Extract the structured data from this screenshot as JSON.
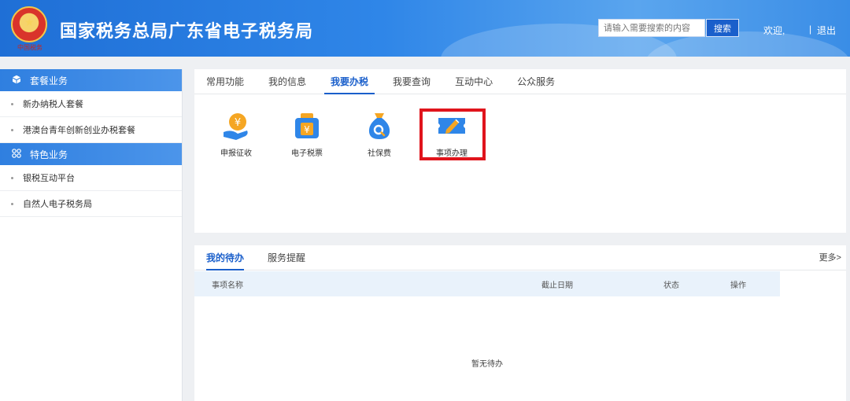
{
  "header": {
    "title": "国家税务总局广东省电子税务局",
    "emblem_caption": "中国税务",
    "search_placeholder": "请输入需要搜索的内容",
    "search_button": "搜索",
    "welcome": "欢迎,",
    "separator": "|",
    "logout": "退出",
    "accent_color": "#2f86e8"
  },
  "sidebar": {
    "groups": [
      {
        "label": "套餐业务",
        "icon": "cube-icon",
        "items": [
          "新办纳税人套餐",
          "港澳台青年创新创业办税套餐"
        ]
      },
      {
        "label": "特色业务",
        "icon": "grid-icon",
        "items": [
          "银税互动平台",
          "自然人电子税务局"
        ]
      }
    ]
  },
  "main": {
    "tabs": [
      "常用功能",
      "我的信息",
      "我要办税",
      "我要查询",
      "互动中心",
      "公众服务"
    ],
    "active_tab": "我要办税",
    "functions": [
      {
        "label": "申报征收",
        "icon": "tax-declare-icon"
      },
      {
        "label": "电子税票",
        "icon": "e-ticket-icon"
      },
      {
        "label": "社保费",
        "icon": "social-security-icon"
      },
      {
        "label": "事项办理",
        "icon": "pencil-ticket-icon"
      }
    ],
    "highlight_color": "#e0141c"
  },
  "todo": {
    "tabs": [
      "我的待办",
      "服务提醒"
    ],
    "more": "更多>",
    "columns": [
      "事项名称",
      "截止日期",
      "状态",
      "操作"
    ],
    "empty_text": "暂无待办"
  }
}
